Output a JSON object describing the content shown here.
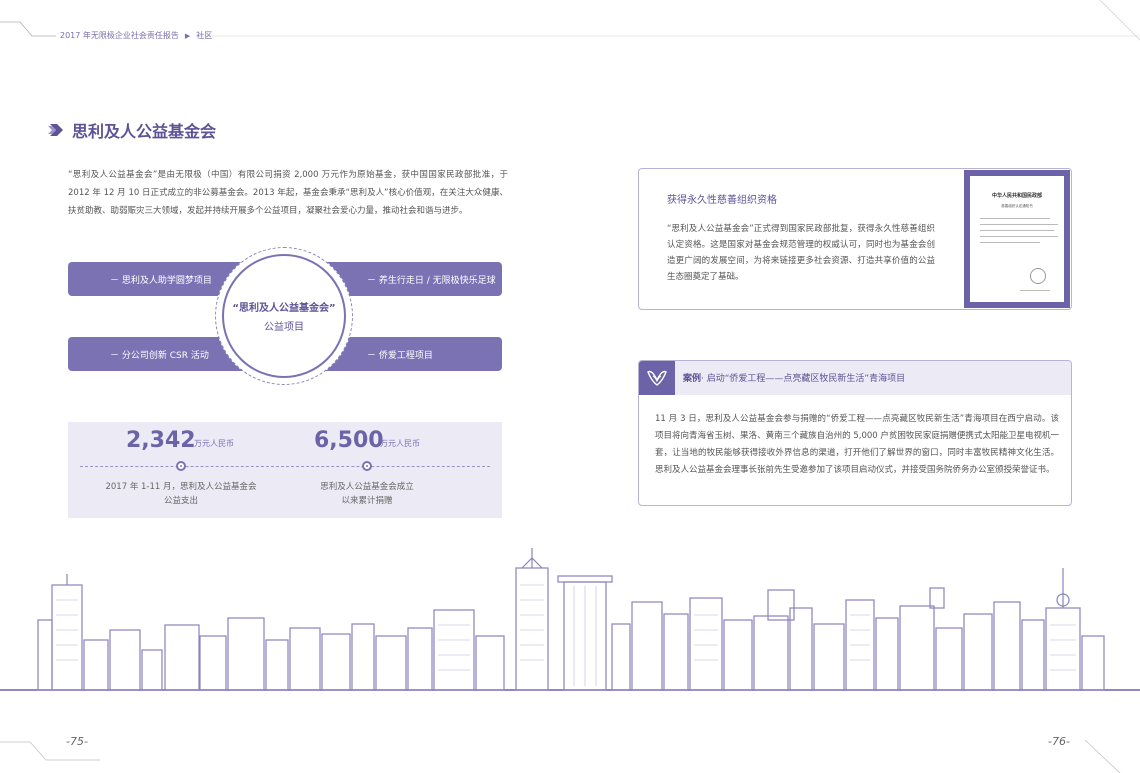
{
  "header": {
    "report_title": "2017 年无限极企业社会责任报告",
    "section": "社区"
  },
  "title": "思利及人公益基金会",
  "intro": "“思利及人公益基金会”是由无限极（中国）有限公司捐资 2,000 万元作为原始基金，获中国国家民政部批准，于 2012 年 12 月 10 日正式成立的非公募基金会。2013 年起，基金会秉承“思利及人”核心价值观，在关注大众健康、扶贫助教、助弱赈灾三大领域，发起并持续开展多个公益项目，凝聚社会爱心力量，推动社会和谐与进步。",
  "projects": {
    "center_line1": "“思利及人公益基金会”",
    "center_line2": "公益项目",
    "top_left": "－ 思利及人助学圆梦项目",
    "top_right": "－ 养生行走日 / 无限极快乐足球",
    "bottom_left": "－ 分公司创新 CSR 活动",
    "bottom_right": "－ 侨爱工程项目"
  },
  "stats": [
    {
      "value": "2,342",
      "unit": "万元人民币",
      "caption_line1": "2017 年 1-11 月，思利及人公益基金会",
      "caption_line2": "公益支出"
    },
    {
      "value": "6,500",
      "unit": "万元人民币",
      "caption_line1": "思利及人公益基金会成立",
      "caption_line2": "以来累计捐赠"
    }
  ],
  "qualification": {
    "heading": "获得永久性慈善组织资格",
    "body": "“思利及人公益基金会”正式得到国家民政部批复，获得永久性慈善组织认定资格。这是国家对基金会规范管理的权威认可，同时也为基金会创造更广阔的发展空间，为将来链接更多社会资源、打造共享价值的公益生态圈奠定了基础。",
    "certificate_title": "中华人民共和国民政部",
    "certificate_subtitle": "慈善组织认定通知书"
  },
  "case": {
    "label": "案例",
    "title": "· 启动“侨爱工程——点亮藏区牧民新生活”青海项目",
    "body": "11 月 3 日，思利及人公益基金会参与捐赠的“侨爱工程——点亮藏区牧民新生活”青海项目在西宁启动。该项目将向青海省玉树、果洛、黄南三个藏族自治州的 5,000 户贫困牧民家庭捐赠便携式太阳能卫星电视机一套，让当地的牧民能够获得接收外界信息的渠道，打开他们了解世界的窗口，同时丰富牧民精神文化生活。思利及人公益基金会理事长张前先生受邀参加了该项目启动仪式，并接受国务院侨务办公室颁授荣誉证书。"
  },
  "pages": {
    "left": "-75-",
    "right": "-76-"
  },
  "colors": {
    "accent": "#7b72b4",
    "accent_dark": "#5d5396",
    "light_bg": "#eceaf4"
  },
  "icons": {
    "title": "chevron-right-icon",
    "case": "hands-logo-icon"
  }
}
